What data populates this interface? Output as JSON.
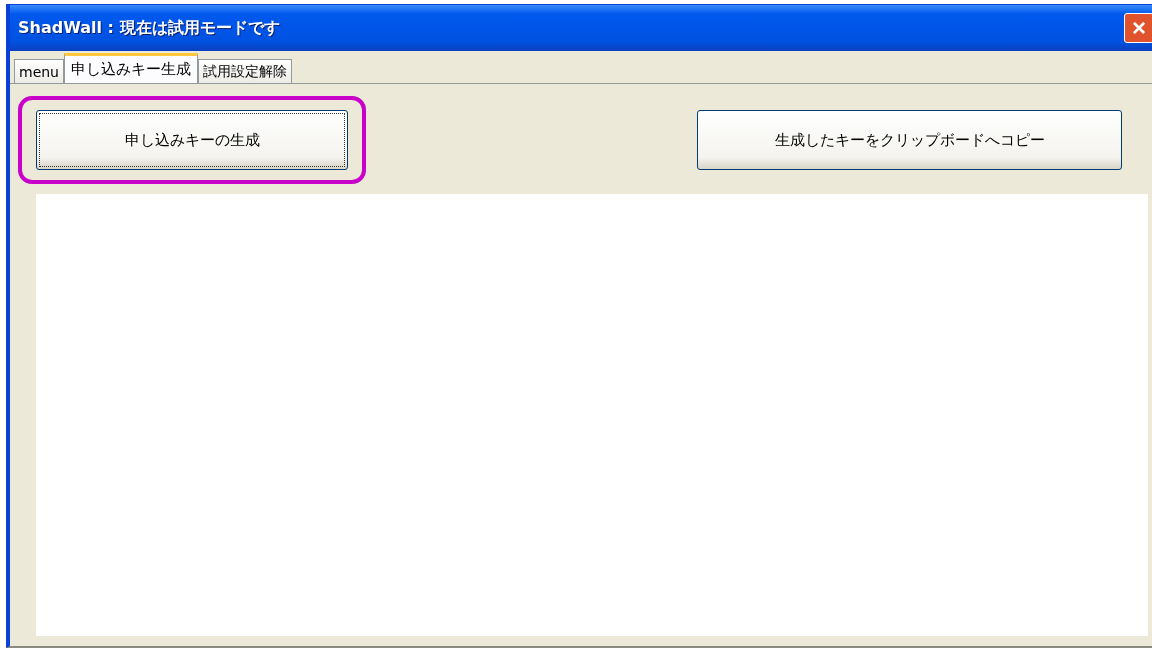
{
  "window": {
    "title": "ShadWall : 現在は試用モードです",
    "close": "×"
  },
  "tabs": [
    {
      "label": "menu",
      "selected": false
    },
    {
      "label": "申し込みキー生成",
      "selected": true
    },
    {
      "label": "試用設定解除",
      "selected": false
    }
  ],
  "buttons": [
    {
      "label": "申し込みキーの生成",
      "highlighted": true
    },
    {
      "label": "生成したキーをクリップボードへコピー",
      "highlighted": false
    }
  ],
  "output": {
    "kind": "text-area"
  }
}
